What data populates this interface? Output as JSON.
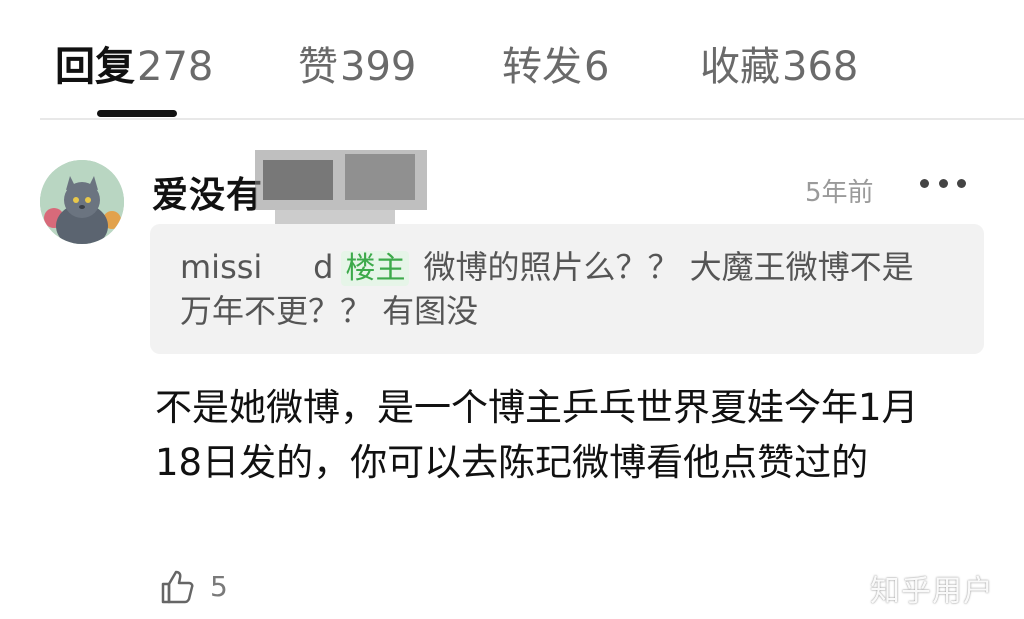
{
  "tabs": [
    {
      "label": "回复",
      "count": "278",
      "active": true
    },
    {
      "label": "赞",
      "count": "399",
      "active": false
    },
    {
      "label": "转发",
      "count": "6",
      "active": false
    },
    {
      "label": "收藏",
      "count": "368",
      "active": false
    }
  ],
  "comment": {
    "username": "爱没有",
    "time": "5年前",
    "quote": {
      "user": "missi",
      "user_tail": "d",
      "badge": "楼主",
      "text": "微博的照片么？？ 大魔王微博不是万年不更？？ 有图没"
    },
    "body": "不是她微博，是一个博主乒乓世界夏娃今年1月18日发的，你可以去陈玘微博看他点赞过的",
    "likes": "5"
  },
  "watermark": "知乎用户",
  "colors": {
    "accent_green": "#3daa4b",
    "quote_bg": "#f2f2f2",
    "muted": "#9a9a9a"
  }
}
